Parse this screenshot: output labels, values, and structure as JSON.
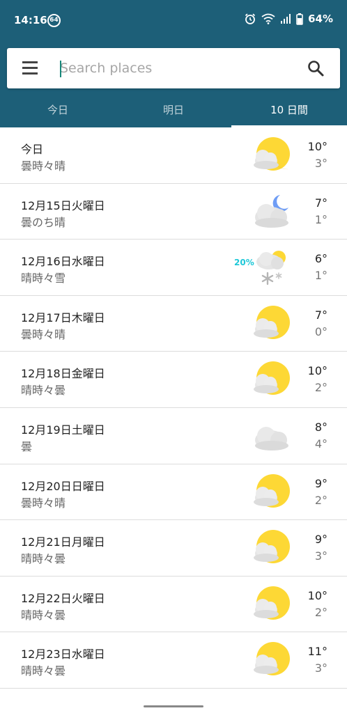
{
  "status_bar": {
    "time": "14:16",
    "badge": "64",
    "battery": "64%"
  },
  "search": {
    "placeholder": "Search places",
    "value": ""
  },
  "tabs": [
    {
      "label": "今日",
      "active": false
    },
    {
      "label": "明日",
      "active": false
    },
    {
      "label": "10 日間",
      "active": true
    }
  ],
  "forecast": [
    {
      "date": "今日",
      "condition": "曇時々晴",
      "high": "10°",
      "low": "3°",
      "icon": "sun-behind-cloud-icon"
    },
    {
      "date": "12月15日火曜日",
      "condition": "曇のち晴",
      "high": "7°",
      "low": "1°",
      "icon": "moon-cloud-icon"
    },
    {
      "date": "12月16日水曜日",
      "condition": "晴時々雪",
      "high": "6°",
      "low": "1°",
      "icon": "snow-cloud-icon",
      "precip": "20%"
    },
    {
      "date": "12月17日木曜日",
      "condition": "曇時々晴",
      "high": "7°",
      "low": "0°",
      "icon": "sun-behind-cloud-icon"
    },
    {
      "date": "12月18日金曜日",
      "condition": "晴時々曇",
      "high": "10°",
      "low": "2°",
      "icon": "sun-behind-cloud-icon"
    },
    {
      "date": "12月19日土曜日",
      "condition": "曇",
      "high": "8°",
      "low": "4°",
      "icon": "cloud-icon"
    },
    {
      "date": "12月20日日曜日",
      "condition": "曇時々晴",
      "high": "9°",
      "low": "2°",
      "icon": "sun-behind-cloud-icon"
    },
    {
      "date": "12月21日月曜日",
      "condition": "晴時々曇",
      "high": "9°",
      "low": "3°",
      "icon": "sun-behind-cloud-icon"
    },
    {
      "date": "12月22日火曜日",
      "condition": "晴時々曇",
      "high": "10°",
      "low": "2°",
      "icon": "sun-behind-cloud-icon"
    },
    {
      "date": "12月23日水曜日",
      "condition": "晴時々曇",
      "high": "11°",
      "low": "3°",
      "icon": "sun-behind-cloud-icon"
    }
  ],
  "colors": {
    "header": "#1d5f78",
    "sun": "#fdd835",
    "cloud": "#e3e3e3",
    "precip": "#1fc8d8"
  }
}
